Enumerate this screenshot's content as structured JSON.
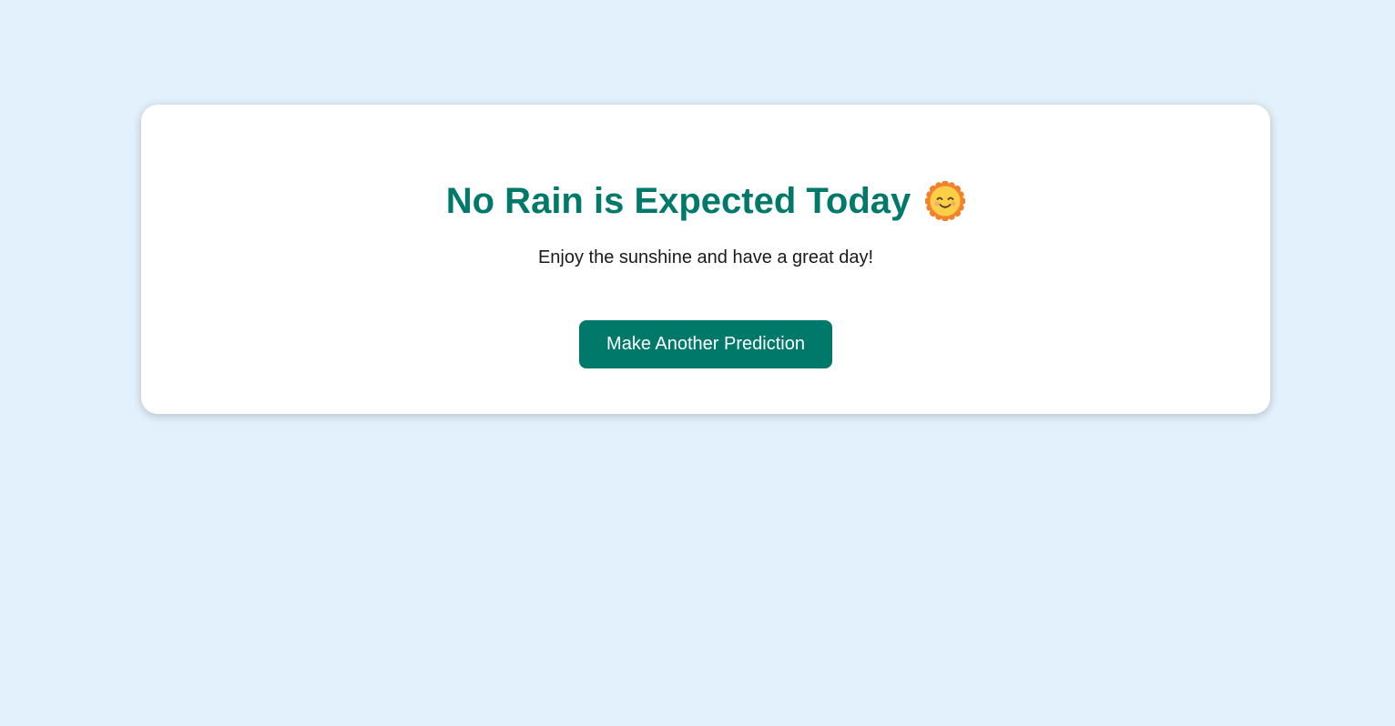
{
  "result": {
    "headline": "No Rain is Expected Today",
    "icon": "smiling-sun-icon",
    "subtitle": "Enjoy the sunshine and have a great day!",
    "button_label": "Make Another Prediction"
  },
  "colors": {
    "background": "#e3f1fc",
    "card": "#ffffff",
    "accent": "#00796b",
    "text": "#1a1a1a",
    "button_text": "#ffffff"
  }
}
